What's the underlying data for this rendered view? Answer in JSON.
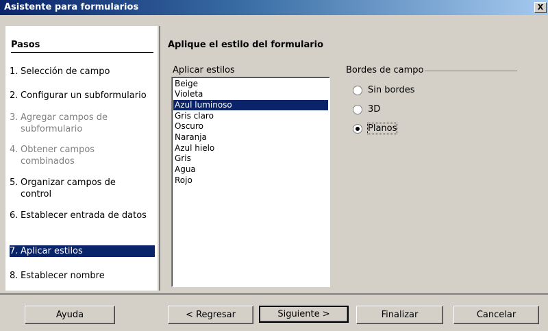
{
  "window": {
    "title": "Asistente para formularios",
    "close": "X"
  },
  "steps": {
    "header": "Pasos",
    "items": [
      {
        "num": "1.",
        "label": "Selección de campo",
        "state": "normal"
      },
      {
        "num": "2.",
        "label": "Configurar un subformulario",
        "state": "normal"
      },
      {
        "num": "3.",
        "label": "Agregar campos de subformulario",
        "state": "disabled"
      },
      {
        "num": "4.",
        "label": "Obtener campos combinados",
        "state": "disabled"
      },
      {
        "num": "5.",
        "label": "Organizar campos de control",
        "state": "normal"
      },
      {
        "num": "6.",
        "label": "Establecer entrada de datos",
        "state": "normal"
      },
      {
        "num": "7.",
        "label": "Aplicar estilos",
        "state": "selected"
      },
      {
        "num": "8.",
        "label": "Establecer nombre",
        "state": "normal"
      }
    ]
  },
  "main": {
    "title": "Aplique el estilo del formulario",
    "list_label": "Aplicar estilos",
    "styles": [
      "Beige",
      "Violeta",
      "Azul luminoso",
      "Gris claro",
      "Oscuro",
      "Naranja",
      "Azul hielo",
      "Gris",
      "Agua",
      "Rojo"
    ],
    "selected_style": "Azul luminoso",
    "borders_label": "Bordes de campo",
    "border_options": [
      {
        "label": "Sin bordes",
        "checked": false
      },
      {
        "label": "3D",
        "checked": false
      },
      {
        "label": "Planos",
        "checked": true
      }
    ]
  },
  "buttons": {
    "help": "Ayuda",
    "back": "< Regresar",
    "next": "Siguiente >",
    "finish": "Finalizar",
    "cancel": "Cancelar"
  }
}
